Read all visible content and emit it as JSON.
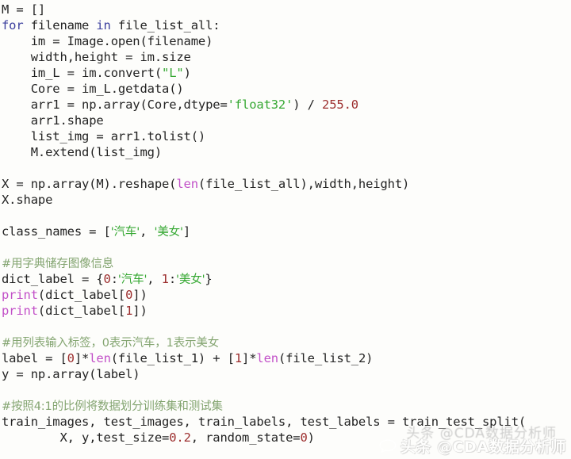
{
  "editor": {
    "language": "python",
    "background_color": "#fdfdfb",
    "font_size_px": 15.5,
    "line_height_px": 20,
    "theme_colors": {
      "plain": "#232323",
      "keyword": "#3b3f9e",
      "builtin": "#c250c8",
      "string": "#35a832",
      "number": "#9c2d2d",
      "comment": "#84a571"
    }
  },
  "code_lines": [
    {
      "id": 1,
      "indent": 0,
      "tokens": [
        {
          "t": "M = []",
          "c": "plain"
        }
      ]
    },
    {
      "id": 2,
      "indent": 0,
      "tokens": [
        {
          "t": "for",
          "c": "keyword"
        },
        {
          "t": " filename ",
          "c": "plain"
        },
        {
          "t": "in",
          "c": "keyword"
        },
        {
          "t": " file_list_all:",
          "c": "plain"
        }
      ]
    },
    {
      "id": 3,
      "indent": 1,
      "tokens": [
        {
          "t": "im = Image.open(filename)",
          "c": "plain"
        }
      ]
    },
    {
      "id": 4,
      "indent": 1,
      "tokens": [
        {
          "t": "width,height = im.size",
          "c": "plain"
        }
      ]
    },
    {
      "id": 5,
      "indent": 1,
      "tokens": [
        {
          "t": "im_L = im.convert(",
          "c": "plain"
        },
        {
          "t": "\"L\"",
          "c": "string"
        },
        {
          "t": ")",
          "c": "plain"
        }
      ]
    },
    {
      "id": 6,
      "indent": 1,
      "tokens": [
        {
          "t": "Core = im_L.getdata()",
          "c": "plain"
        }
      ]
    },
    {
      "id": 7,
      "indent": 1,
      "tokens": [
        {
          "t": "arr1 = np.array(Core,dtype=",
          "c": "plain"
        },
        {
          "t": "'float32'",
          "c": "string"
        },
        {
          "t": ") / ",
          "c": "plain"
        },
        {
          "t": "255.0",
          "c": "number"
        }
      ]
    },
    {
      "id": 8,
      "indent": 1,
      "tokens": [
        {
          "t": "arr1.shape",
          "c": "plain"
        }
      ]
    },
    {
      "id": 9,
      "indent": 1,
      "tokens": [
        {
          "t": "list_img = arr1.tolist()",
          "c": "plain"
        }
      ]
    },
    {
      "id": 10,
      "indent": 1,
      "tokens": [
        {
          "t": "M.extend(list_img)",
          "c": "plain"
        }
      ]
    },
    {
      "id": 11,
      "indent": 0,
      "tokens": []
    },
    {
      "id": 12,
      "indent": 0,
      "tokens": [
        {
          "t": "X = np.array(M).reshape(",
          "c": "plain"
        },
        {
          "t": "len",
          "c": "builtin"
        },
        {
          "t": "(file_list_all),width,height)",
          "c": "plain"
        }
      ]
    },
    {
      "id": 13,
      "indent": 0,
      "tokens": [
        {
          "t": "X.shape",
          "c": "plain"
        }
      ]
    },
    {
      "id": 14,
      "indent": 0,
      "tokens": []
    },
    {
      "id": 15,
      "indent": 0,
      "tokens": [
        {
          "t": "class_names = [",
          "c": "plain"
        },
        {
          "t": "'汽车'",
          "c": "string",
          "cjk": true
        },
        {
          "t": ", ",
          "c": "plain"
        },
        {
          "t": "'美女'",
          "c": "string",
          "cjk": true
        },
        {
          "t": "]",
          "c": "plain"
        }
      ]
    },
    {
      "id": 16,
      "indent": 0,
      "tokens": []
    },
    {
      "id": 17,
      "indent": 0,
      "tokens": [
        {
          "t": "#用字典储存图像信息",
          "c": "comment",
          "cjk": true
        }
      ]
    },
    {
      "id": 18,
      "indent": 0,
      "tokens": [
        {
          "t": "dict_label = {",
          "c": "plain"
        },
        {
          "t": "0",
          "c": "number"
        },
        {
          "t": ":",
          "c": "plain"
        },
        {
          "t": "'汽车'",
          "c": "string",
          "cjk": true
        },
        {
          "t": ", ",
          "c": "plain"
        },
        {
          "t": "1",
          "c": "number"
        },
        {
          "t": ":",
          "c": "plain"
        },
        {
          "t": "'美女'",
          "c": "string",
          "cjk": true
        },
        {
          "t": "}",
          "c": "plain"
        }
      ]
    },
    {
      "id": 19,
      "indent": 0,
      "tokens": [
        {
          "t": "print",
          "c": "builtin"
        },
        {
          "t": "(dict_label[",
          "c": "plain"
        },
        {
          "t": "0",
          "c": "number"
        },
        {
          "t": "])",
          "c": "plain"
        }
      ]
    },
    {
      "id": 20,
      "indent": 0,
      "tokens": [
        {
          "t": "print",
          "c": "builtin"
        },
        {
          "t": "(dict_label[",
          "c": "plain"
        },
        {
          "t": "1",
          "c": "number"
        },
        {
          "t": "])",
          "c": "plain"
        }
      ]
    },
    {
      "id": 21,
      "indent": 0,
      "tokens": []
    },
    {
      "id": 22,
      "indent": 0,
      "tokens": [
        {
          "t": "#用列表输入标签，0表示汽车，1表示美女",
          "c": "comment",
          "cjk": true
        }
      ]
    },
    {
      "id": 23,
      "indent": 0,
      "tokens": [
        {
          "t": "label = [",
          "c": "plain"
        },
        {
          "t": "0",
          "c": "number"
        },
        {
          "t": "]*",
          "c": "plain"
        },
        {
          "t": "len",
          "c": "builtin"
        },
        {
          "t": "(file_list_1) + [",
          "c": "plain"
        },
        {
          "t": "1",
          "c": "number"
        },
        {
          "t": "]*",
          "c": "plain"
        },
        {
          "t": "len",
          "c": "builtin"
        },
        {
          "t": "(file_list_2)",
          "c": "plain"
        }
      ]
    },
    {
      "id": 24,
      "indent": 0,
      "tokens": [
        {
          "t": "y = np.array(label)",
          "c": "plain"
        }
      ]
    },
    {
      "id": 25,
      "indent": 0,
      "tokens": []
    },
    {
      "id": 26,
      "indent": 0,
      "tokens": [
        {
          "t": "#按照4:1的比例将数据划分训练集和测试集",
          "c": "comment",
          "cjk": true
        }
      ]
    },
    {
      "id": 27,
      "indent": 0,
      "tokens": [
        {
          "t": "train_images, test_images, train_labels, test_labels = train_test_split(",
          "c": "plain"
        }
      ]
    },
    {
      "id": 28,
      "indent": 2,
      "tokens": [
        {
          "t": "X, y,test_size=",
          "c": "plain"
        },
        {
          "t": "0.2",
          "c": "number"
        },
        {
          "t": ", random_state=",
          "c": "plain"
        },
        {
          "t": "0",
          "c": "number"
        },
        {
          "t": ")",
          "c": "plain"
        }
      ]
    }
  ],
  "watermark": {
    "icon": "speech-bubble-icon",
    "text": "头条 @CDA数据分析师",
    "ghost_text": "头条 @CDA数据分析师"
  }
}
